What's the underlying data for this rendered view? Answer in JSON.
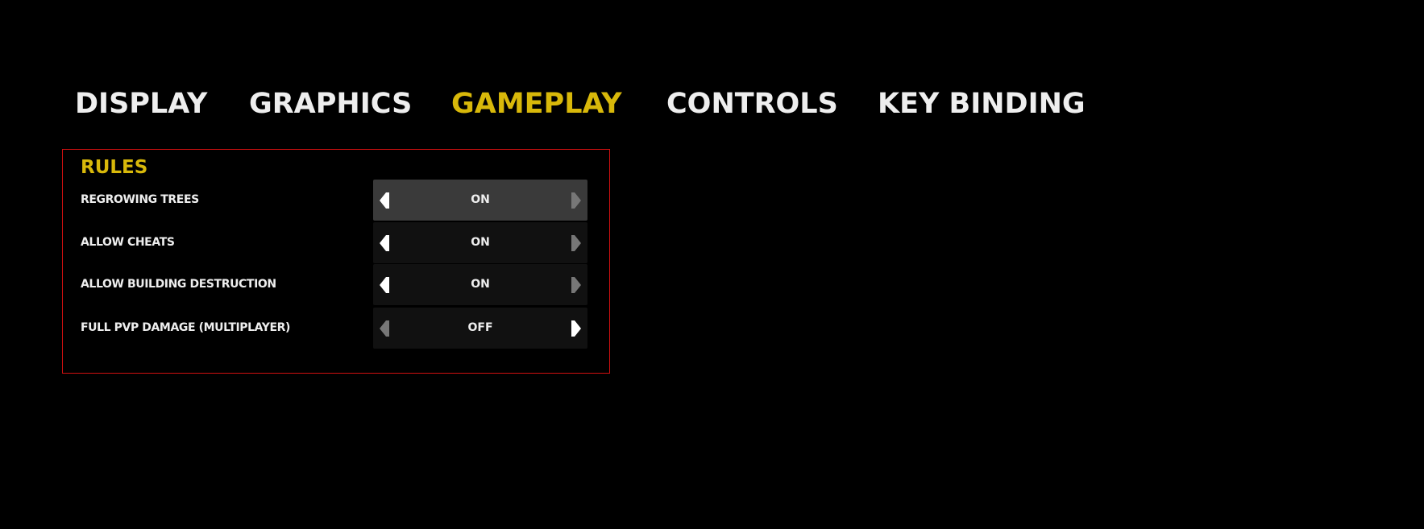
{
  "tabs": [
    {
      "label": "DISPLAY",
      "active": false
    },
    {
      "label": "GRAPHICS",
      "active": false
    },
    {
      "label": "GAMEPLAY",
      "active": true
    },
    {
      "label": "CONTROLS",
      "active": false
    },
    {
      "label": "KEY BINDING",
      "active": false
    }
  ],
  "colors": {
    "accent": "#d8b80a",
    "text": "#eeeeee",
    "box_border": "#d01010",
    "selector_bg": "#111111",
    "selector_highlight_bg": "#3a3a3a",
    "arrow_enabled": "#ffffff",
    "arrow_disabled": "#777777"
  },
  "rules": {
    "title": "RULES",
    "rows": [
      {
        "label": "REGROWING TREES",
        "value": "ON",
        "highlighted": true,
        "left_enabled": true,
        "right_enabled": false
      },
      {
        "label": "ALLOW CHEATS",
        "value": "ON",
        "highlighted": false,
        "left_enabled": true,
        "right_enabled": false
      },
      {
        "label": "ALLOW BUILDING DESTRUCTION",
        "value": "ON",
        "highlighted": false,
        "left_enabled": true,
        "right_enabled": false
      },
      {
        "label": "FULL PVP DAMAGE (MULTIPLAYER)",
        "value": "OFF",
        "highlighted": false,
        "left_enabled": false,
        "right_enabled": true
      }
    ]
  }
}
